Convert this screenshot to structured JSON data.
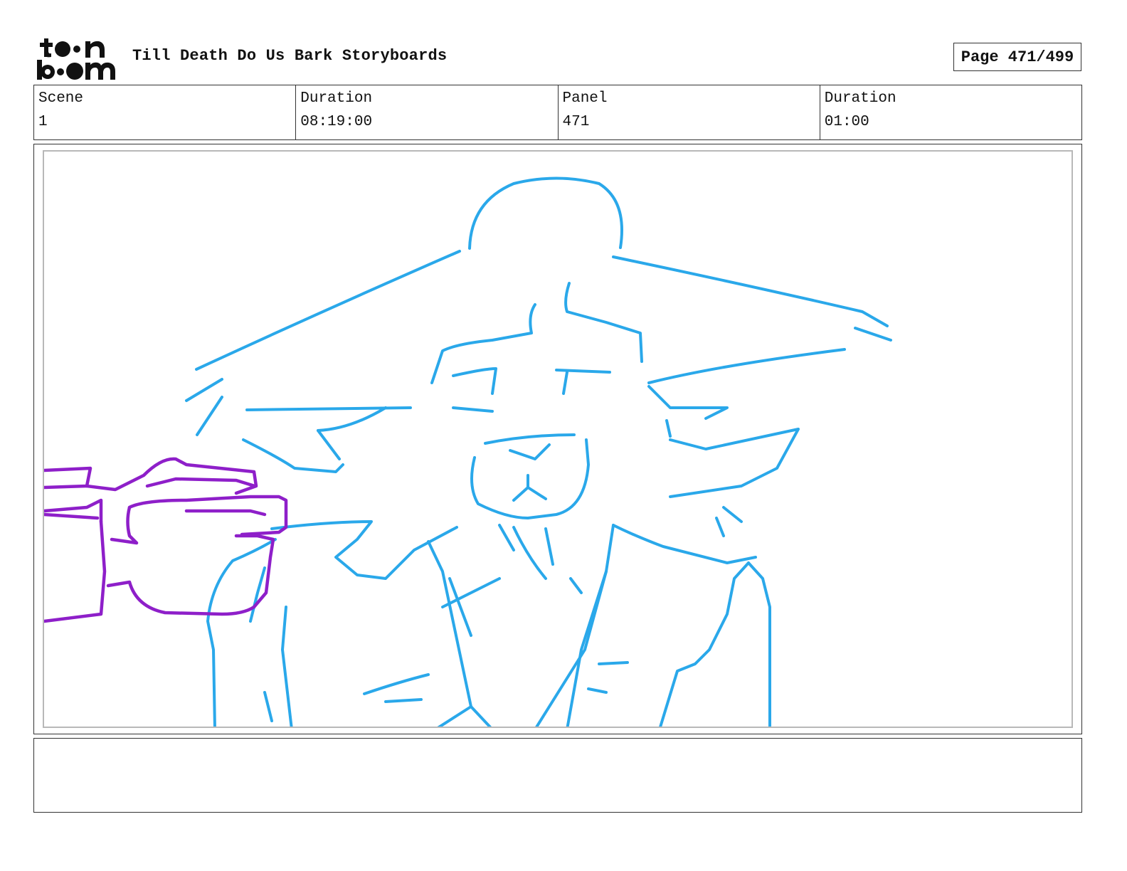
{
  "header": {
    "logo_text": "toon boom",
    "title": "Till Death Do Us Bark Storyboards",
    "page_label": "Page 471/499"
  },
  "info": {
    "scene_label": "Scene",
    "scene_value": "1",
    "scene_duration_label": "Duration",
    "scene_duration_value": "08:19:00",
    "panel_label": "Panel",
    "panel_value": "471",
    "panel_duration_label": "Duration",
    "panel_duration_value": "01:00"
  },
  "panel": {
    "sketch_colors": {
      "character": "#2aa8ea",
      "hand": "#8e1fc9"
    }
  },
  "notes": {
    "text": ""
  }
}
